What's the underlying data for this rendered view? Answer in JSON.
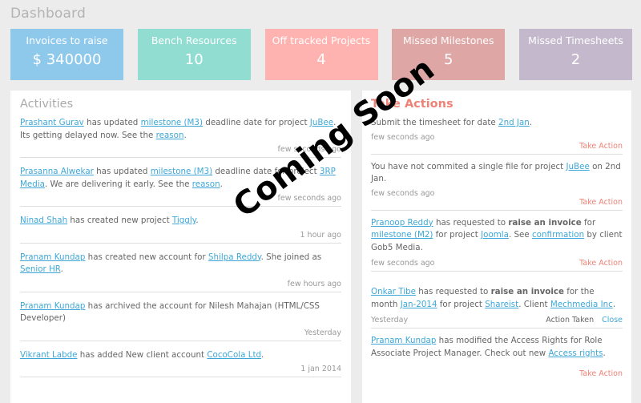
{
  "page_title": "Dashboard",
  "stats": [
    {
      "label": "Invoices to raise",
      "value": "$ 340000",
      "color": "#8ec9ec"
    },
    {
      "label": "Bench Resources",
      "value": "10",
      "color": "#91ddd1"
    },
    {
      "label": "Off tracked Projects",
      "value": "4",
      "color": "#ffb3b1"
    },
    {
      "label": "Missed Milestones",
      "value": "5",
      "color": "#dfa6a6"
    },
    {
      "label": "Missed Timesheets",
      "value": "2",
      "color": "#c4b9cc"
    }
  ],
  "activities": {
    "title": "Activities",
    "items": [
      {
        "l1": "Prashant Gurav",
        "t1": " has updated ",
        "l2": "milestone (M3)",
        "t2": " deadline date for project ",
        "l3": "JuBee",
        "t3": ". Its getting delayed now. See the ",
        "l4": "reason",
        "t4": ".",
        "time": "few seconds ago"
      },
      {
        "l1": "Prasanna Alwekar",
        "t1": " has updated ",
        "l2": "milestone (M3)",
        "t2": " deadline date for project ",
        "l3": "3RP Media",
        "t3": ". We are delivering it early. See the ",
        "l4": "reason",
        "t4": ".",
        "time": "few seconds ago"
      },
      {
        "l1": "Ninad Shah",
        "t1": " has created new project ",
        "l2": "Tiggly",
        "t2": ".",
        "time": "1 hour ago"
      },
      {
        "l1": "Pranam Kundap",
        "t1": " has created new account for ",
        "l2": "Shilpa Reddy",
        "t2": ". She joined as ",
        "l3": "Senior HR",
        "t3": ".",
        "time": "few hours ago"
      },
      {
        "l1": "Pranam Kundap",
        "t1": " has archived the account for Nilesh Mahajan (HTML/CSS Developer)",
        "time": "Yesterday"
      },
      {
        "l1": "Vikrant Labde",
        "t1": " has added New client account ",
        "l2": "CocoCola Ltd",
        "t2": ".",
        "time": "1 jan 2014"
      }
    ]
  },
  "actions": {
    "title": "Take Actions",
    "take_action_label": "Take Action",
    "action_taken_label": "Action Taken",
    "close_label": "Close",
    "items": [
      {
        "t0": "Submit the timesheet for date ",
        "l1": "2nd Jan",
        "t1": ".",
        "time": "few seconds ago"
      },
      {
        "t0": "You have not commited a single file for project ",
        "l1": "JuBee",
        "t1": " on 2nd Jan.",
        "time": "few seconds ago"
      },
      {
        "l0": "Pranoop Reddy",
        "t0": " has requested to ",
        "b0": "raise an invoice",
        "t1": " for ",
        "l1": "milestone (M2)",
        "t2": " for project ",
        "l2": "Joomla",
        "t3": ". See ",
        "l3": "confirmation",
        "t4": " by client  Gob5 Media.",
        "time": "few seconds ago"
      },
      {
        "l0": "Onkar Tibe",
        "t0": " has requested to ",
        "b0": "raise an invoice",
        "t1": " for the month ",
        "l1": "Jan-2014",
        "t2": " for project ",
        "l2": "Shareist",
        "t3": ". Client ",
        "l3": "Mechmedia Inc",
        "t4": ".",
        "time": "Yesterday"
      },
      {
        "l0": "Pranam Kundap",
        "t0": " has modified the Access Rights for Role Associate Project Manager. Check out new ",
        "l1": "Access rights",
        "t1": "."
      }
    ]
  },
  "overlay_text": "Coming Soon"
}
